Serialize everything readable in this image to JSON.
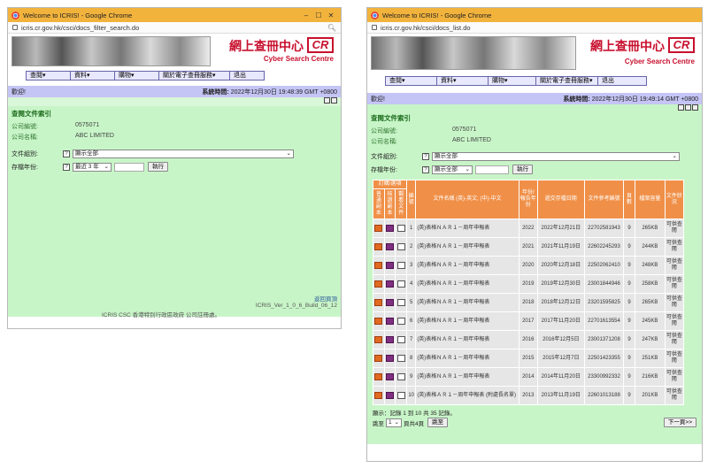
{
  "left": {
    "window_title": "Welcome to ICRIS! - Google Chrome",
    "url": "icris.cr.gov.hk/csci/docs_filter_search.do",
    "logo_cn": "網上查冊中心",
    "logo_cr": "CR",
    "logo_en": "Cyber Search Centre",
    "nav": [
      "查閱▾",
      "資料▾",
      "購物▾",
      "關於電子查冊服務▾",
      "退出"
    ],
    "welcome": "歡迎!",
    "sys_time_label": "系統時間:",
    "sys_time": "2022年12月30日 19:48:39 GMT +0800",
    "section_title": "查閱文件索引",
    "company_no_label": "公司編號:",
    "company_no": "0575071",
    "company_name_label": "公司名稱:",
    "company_name": "ABC LIMITED",
    "doc_group_label": "文件組別:",
    "doc_group_value": "顯示全部",
    "year_label": "存檔年份:",
    "year_value": "最近 3 年",
    "go_button": "執行",
    "back_top": "返回頁頂",
    "version": "ICRIS_Ver_1_0_6_Build_06_12",
    "copyright": "ICRIS CSC 香港特別行政區政府 公司註冊處。"
  },
  "right": {
    "window_title": "Welcome to ICRIS! - Google Chrome",
    "url": "icris.cr.gov.hk/csci/docs_list.do",
    "logo_cn": "網上查冊中心",
    "logo_cr": "CR",
    "logo_en": "Cyber Search Centre",
    "nav": [
      "查閱▾",
      "資料▾",
      "購物▾",
      "關於電子查冊服務▾",
      "退出"
    ],
    "welcome": "歡迎!",
    "sys_time_label": "系統時間:",
    "sys_time": "2022年12月30日 19:49:14 GMT +0800",
    "section_title": "查閱文件索引",
    "company_no_label": "公司編號:",
    "company_no": "0575071",
    "company_name_label": "公司名稱:",
    "company_name": "ABC LIMITED",
    "doc_group_label": "文件組別:",
    "doc_group_value": "顯示全部",
    "year_label": "存檔年份:",
    "year_value": "顯示全部",
    "go_button": "執行",
    "headers": {
      "order_group": "訂購/選項",
      "h_copy": "普通副本",
      "h_cert": "核證副本",
      "h_view": "觀看文件",
      "h_no": "編號",
      "h_name": "文件名稱 (英)-英文; (中)-中文",
      "h_year": "年份/報告年份",
      "h_date": "遞交存檔日期",
      "h_ref": "文件參考編號",
      "h_pages": "頁數",
      "h_size": "檔案容量",
      "h_status": "文件狀況"
    },
    "rows": [
      {
        "no": "1",
        "name": "(英)表格ＮＡＲ１－周年申報表",
        "year": "2022",
        "date": "2022年12月21日",
        "ref": "22702581943",
        "pages": "9",
        "size": "265KB",
        "status": "可供查閱"
      },
      {
        "no": "2",
        "name": "(英)表格ＮＡＲ１－周年申報表",
        "year": "2021",
        "date": "2021年11月19日",
        "ref": "22602245293",
        "pages": "9",
        "size": "244KB",
        "status": "可供查閱"
      },
      {
        "no": "3",
        "name": "(英)表格ＮＡＲ１－周年申報表",
        "year": "2020",
        "date": "2020年12月18日",
        "ref": "22502062410",
        "pages": "9",
        "size": "248KB",
        "status": "可供查閱"
      },
      {
        "no": "4",
        "name": "(英)表格ＮＡＲ１－周年申報表",
        "year": "2019",
        "date": "2019年12月30日",
        "ref": "23001844946",
        "pages": "9",
        "size": "258KB",
        "status": "可供查閱"
      },
      {
        "no": "5",
        "name": "(英)表格ＮＡＲ１－周年申報表",
        "year": "2018",
        "date": "2018年12月12日",
        "ref": "23201595825",
        "pages": "9",
        "size": "265KB",
        "status": "可供查閱"
      },
      {
        "no": "6",
        "name": "(英)表格ＮＡＲ１－周年申報表",
        "year": "2017",
        "date": "2017年11月20日",
        "ref": "22701613554",
        "pages": "9",
        "size": "245KB",
        "status": "可供查閱"
      },
      {
        "no": "7",
        "name": "(英)表格ＮＡＲ１－周年申報表",
        "year": "2016",
        "date": "2016年12月5日",
        "ref": "23001371208",
        "pages": "9",
        "size": "247KB",
        "status": "可供查閱"
      },
      {
        "no": "8",
        "name": "(英)表格ＮＡＲ１－周年申報表",
        "year": "2015",
        "date": "2015年12月7日",
        "ref": "22501423355",
        "pages": "9",
        "size": "251KB",
        "status": "可供查閱"
      },
      {
        "no": "9",
        "name": "(英)表格ＮＡＲ１－周年申報表",
        "year": "2014",
        "date": "2014年11月20日",
        "ref": "23300992332",
        "pages": "9",
        "size": "216KB",
        "status": "可供查閱"
      },
      {
        "no": "10",
        "name": "(英)表格ＡＲ１－周年申報表 (附處長名單)",
        "year": "2013",
        "date": "2013年11月19日",
        "ref": "22601013188",
        "pages": "9",
        "size": "201KB",
        "status": "可供查閱"
      }
    ],
    "showing": "顯示：記錄 1 到 10 共 35 記錄。",
    "jump_label": "跳至",
    "page_value": "1",
    "page_of": "頁共4頁",
    "jump_button": "跳至",
    "next_button": "下一頁>>"
  }
}
